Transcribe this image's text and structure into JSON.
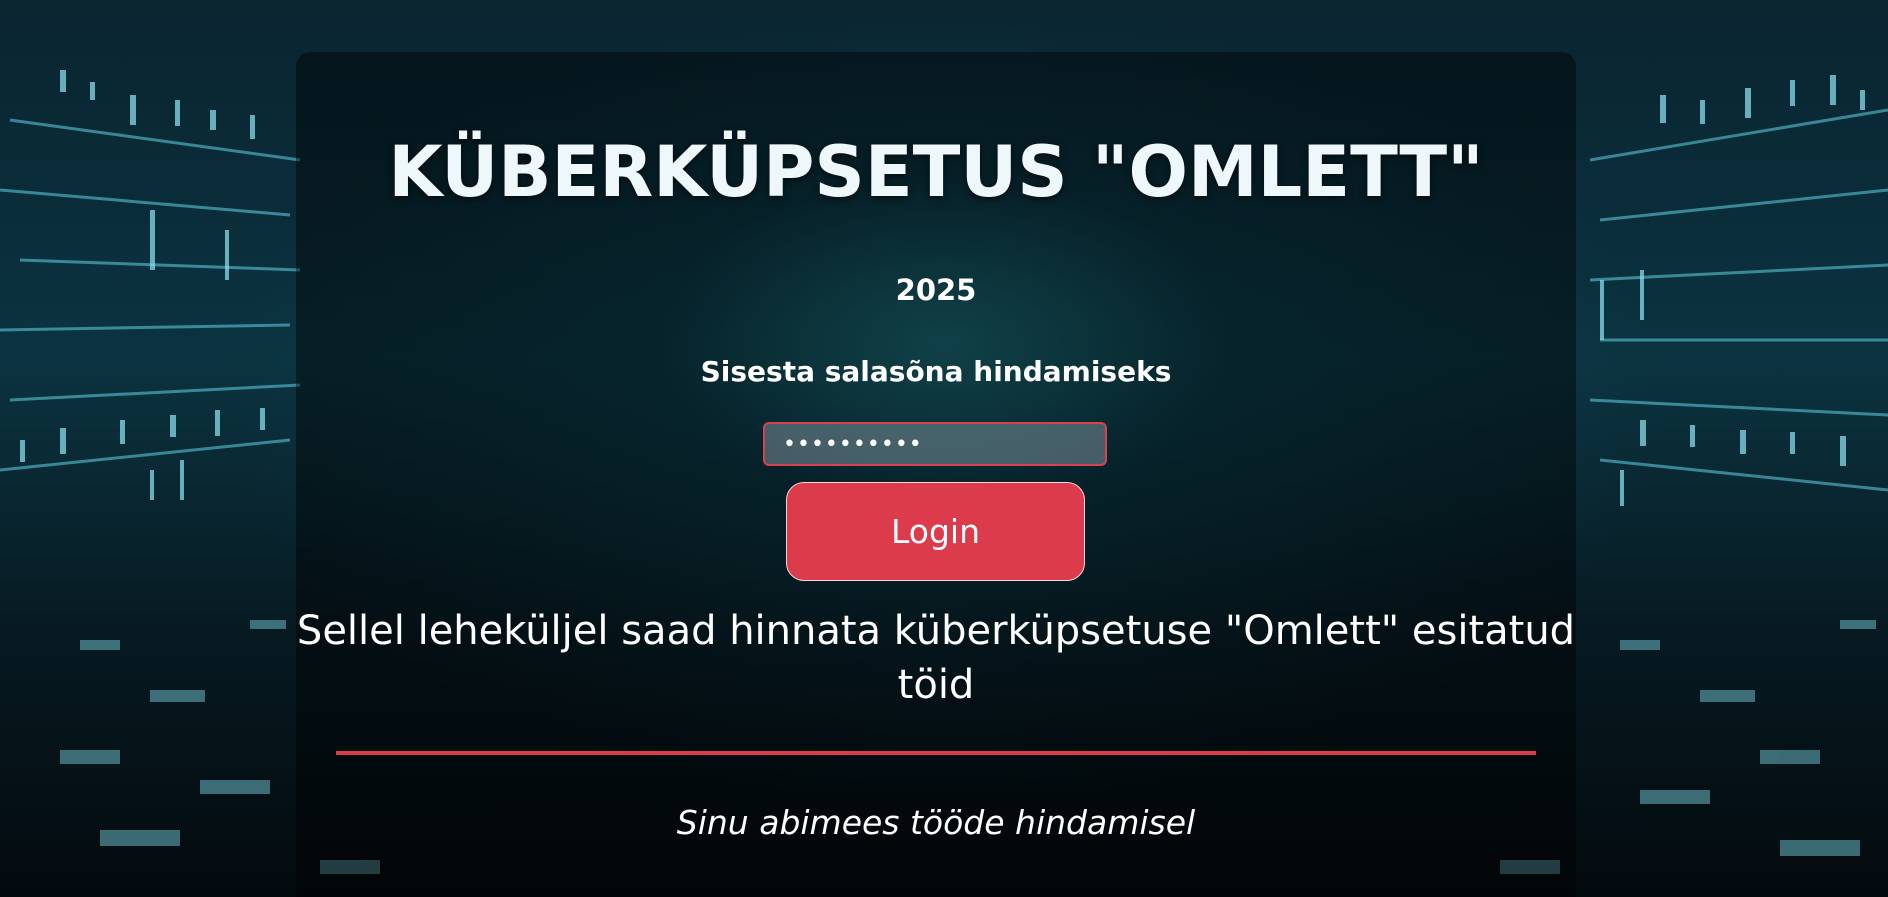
{
  "header": {
    "title": "KÜBERKÜPSETUS \"OMLETT\"",
    "year": "2025"
  },
  "login": {
    "prompt": "Sisesta salasõna hindamiseks",
    "password_value": "••••••••••",
    "button_label": "Login"
  },
  "content": {
    "description": "Sellel leheküljel saad hinnata küberküpsetuse \"Omlett\" esitatud töid",
    "tagline": "Sinu abimees tööde hindamisel"
  },
  "colors": {
    "accent": "#dc3b4b",
    "text": "#ffffff",
    "background": "#0b3340"
  },
  "background_image": "cyber-data-tunnel"
}
